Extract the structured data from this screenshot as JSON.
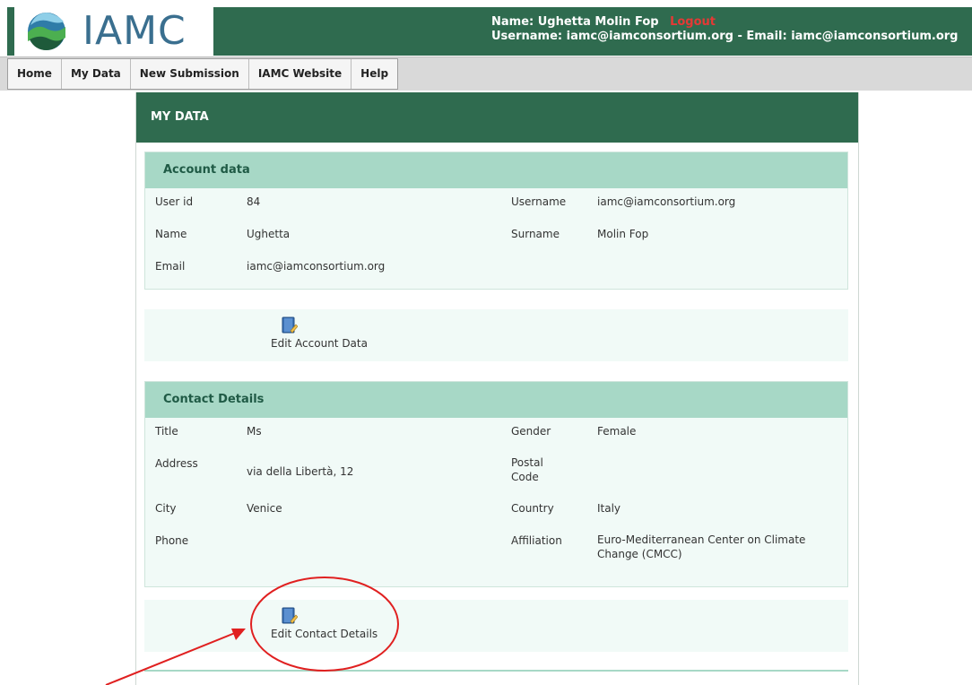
{
  "brand": {
    "name": "IAMC"
  },
  "user": {
    "name_line": "Name: Ughetta Molin Fop",
    "logout_label": "Logout",
    "account_line": "Username: iamc@iamconsortium.org - Email: iamc@iamconsortium.org"
  },
  "nav": {
    "items": [
      "Home",
      "My Data",
      "New Submission",
      "IAMC Website",
      "Help"
    ]
  },
  "page": {
    "title": "MY DATA"
  },
  "account": {
    "header": "Account data",
    "user_id_label": "User id",
    "user_id_value": "84",
    "username_label": "Username",
    "username_value": "iamc@iamconsortium.org",
    "name_label": "Name",
    "name_value": "Ughetta",
    "surname_label": "Surname",
    "surname_value": "Molin Fop",
    "email_label": "Email",
    "email_value": "iamc@iamconsortium.org",
    "edit_label": "Edit Account Data"
  },
  "contact": {
    "header": "Contact Details",
    "title_label": "Title",
    "title_value": "Ms",
    "gender_label": "Gender",
    "gender_value": "Female",
    "address_label": "Address",
    "address_value": "via della Libertà, 12",
    "postal_label_1": "Postal",
    "postal_label_2": "Code",
    "postal_value": "",
    "city_label": "City",
    "city_value": "Venice",
    "country_label": "Country",
    "country_value": "Italy",
    "phone_label": "Phone",
    "phone_value": "",
    "affiliation_label": "Affiliation",
    "affiliation_value_1": "Euro-Mediterranean Center on Climate",
    "affiliation_value_2": "Change (CMCC)",
    "edit_label": "Edit Contact Details"
  },
  "colors": {
    "header_bg": "#2f6b4f",
    "section_header_bg": "#a7d8c6",
    "panel_bg": "#f1faf7",
    "logout": "#e53935",
    "annotation": "#e02020"
  },
  "icons": [
    "logo-icon",
    "edit-book-icon"
  ]
}
